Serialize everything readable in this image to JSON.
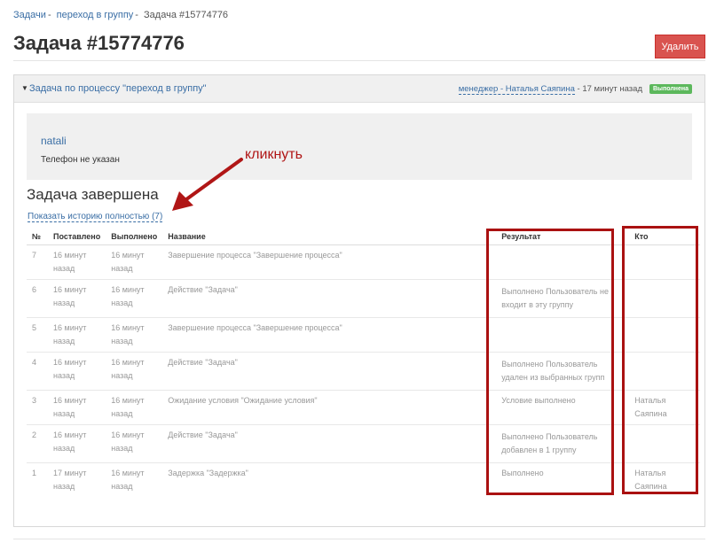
{
  "breadcrumb": {
    "items": [
      "Задачи",
      "переход в группу",
      "Задача #15774776"
    ],
    "separator": "-"
  },
  "title": "Задача #15774776",
  "delete_label": "Удалить",
  "panel": {
    "process_title": "Задача по процессу \"переход в группу\"",
    "meta_who": "менеджер - Наталья Саяпина",
    "meta_when": "- 17 минут назад",
    "badge": "Выполнена",
    "badge_color": "#5cb85c"
  },
  "user": {
    "name": "natali",
    "phone": "Телефон не указан"
  },
  "annotation": "кликнуть",
  "done_title": "Задача завершена",
  "history_link": "Показать историю полностью (7)",
  "table": {
    "headers": [
      "№",
      "Поставлено",
      "Выполнено",
      "Название",
      "Результат",
      "Кто"
    ],
    "rows": [
      {
        "n": "7",
        "set": "16 минут назад",
        "done": "16 минут назад",
        "name": "Завершение процесса \"Завершение процесса\"",
        "result": "",
        "who": ""
      },
      {
        "n": "6",
        "set": "16 минут назад",
        "done": "16 минут назад",
        "name": "Действие \"Задача\"",
        "result": "Выполнено  Пользователь не входит в эту группу",
        "who": ""
      },
      {
        "n": "5",
        "set": "16 минут назад",
        "done": "16 минут назад",
        "name": "Завершение процесса \"Завершение процесса\"",
        "result": "",
        "who": ""
      },
      {
        "n": "4",
        "set": "16 минут назад",
        "done": "16 минут назад",
        "name": "Действие \"Задача\"",
        "result": "Выполнено  Пользователь удален из выбранных групп",
        "who": ""
      },
      {
        "n": "3",
        "set": "16 минут назад",
        "done": "16 минут назад",
        "name": "Ожидание условия \"Ожидание условия\"",
        "result": "Условие выполнено",
        "who": "Наталья Саяпина"
      },
      {
        "n": "2",
        "set": "16 минут назад",
        "done": "16 минут назад",
        "name": "Действие \"Задача\"",
        "result": "Выполнено  Пользователь добавлен в 1 группу",
        "who": ""
      },
      {
        "n": "1",
        "set": "17 минут назад",
        "done": "16 минут назад",
        "name": "Задержка \"Задержка\"",
        "result": "Выполнено",
        "who": "Наталья Саяпина"
      }
    ]
  },
  "colors": {
    "link": "#3a6ea5",
    "danger": "#d9534f",
    "highlight": "#a11111"
  }
}
